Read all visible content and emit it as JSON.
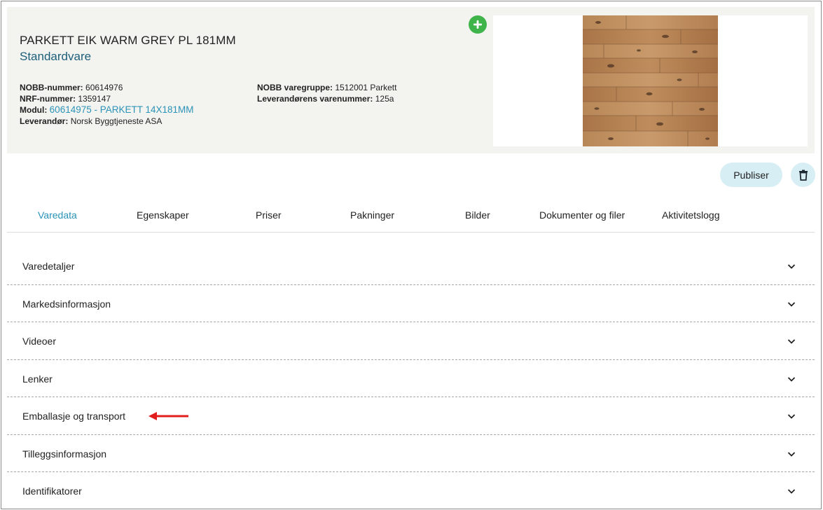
{
  "product": {
    "title": "PARKETT EIK WARM GREY PL 181MM",
    "subtitle": "Standardvare",
    "nobb_label": "NOBB-nummer:",
    "nobb_value": "60614976",
    "nrf_label": "NRF-nummer:",
    "nrf_value": "1359147",
    "modul_label": "Modul:",
    "modul_value": "60614975 - PARKETT 14X181MM",
    "leverandor_label": "Leverandør:",
    "leverandor_value": "Norsk Byggtjeneste ASA",
    "varegruppe_label": "NOBB varegruppe:",
    "varegruppe_value": "1512001 Parkett",
    "varenummer_label": "Leverandørens varenummer:",
    "varenummer_value": "125a",
    "image_icon": "wood-floor-image"
  },
  "actions": {
    "add_icon": "plus-icon",
    "publish_label": "Publiser",
    "delete_icon": "trash-icon"
  },
  "tabs": [
    {
      "label": "Varedata",
      "active": true
    },
    {
      "label": "Egenskaper",
      "active": false
    },
    {
      "label": "Priser",
      "active": false
    },
    {
      "label": "Pakninger",
      "active": false
    },
    {
      "label": "Bilder",
      "active": false
    },
    {
      "label": "Dokumenter og filer",
      "active": false
    },
    {
      "label": "Aktivitetslogg",
      "active": false
    }
  ],
  "sections": [
    {
      "label": "Varedetaljer"
    },
    {
      "label": "Markedsinformasjon"
    },
    {
      "label": "Videoer"
    },
    {
      "label": "Lenker"
    },
    {
      "label": "Emballasje og transport"
    },
    {
      "label": "Tilleggsinformasjon"
    },
    {
      "label": "Identifikatorer"
    }
  ],
  "colors": {
    "accent": "#2b93b8",
    "subtitle": "#1d5f7a",
    "add_button": "#3fb44a",
    "action_bg": "#d7eef4",
    "annotation_arrow": "#e11d1d"
  }
}
